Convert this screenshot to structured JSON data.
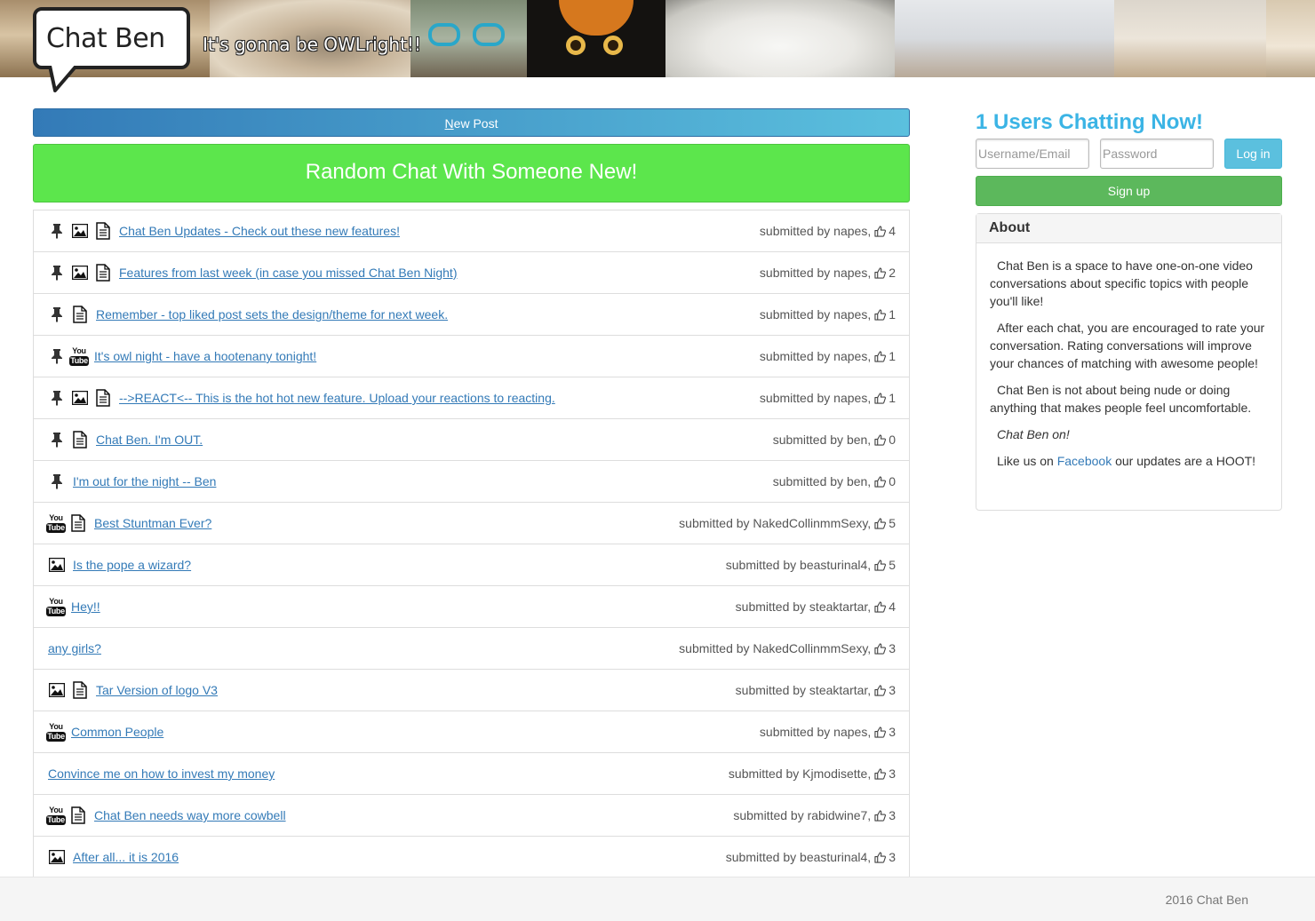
{
  "header": {
    "logo": "Chat Ben",
    "tagline": "It's gonna be OWLright!!"
  },
  "main": {
    "new_post": {
      "underlined": "N",
      "rest": "ew Post"
    },
    "random_chat": "Random Chat With Someone New!",
    "posts": [
      {
        "pinned": true,
        "icons": [
          "image-icon",
          "document-icon"
        ],
        "title": "Chat Ben Updates - Check out these new features!",
        "submitted": "submitted by napes,",
        "likes": "4"
      },
      {
        "pinned": true,
        "icons": [
          "image-icon",
          "document-icon"
        ],
        "title": "Features from last week (in case you missed Chat Ben Night)",
        "submitted": "submitted by napes,",
        "likes": "2"
      },
      {
        "pinned": true,
        "icons": [
          "document-icon"
        ],
        "title": "Remember - top liked post sets the design/theme for next week.",
        "submitted": "submitted by napes,",
        "likes": "1"
      },
      {
        "pinned": true,
        "icons": [
          "youtube-icon"
        ],
        "title": "It's owl night - have a hootenany tonight!",
        "submitted": "submitted by napes,",
        "likes": "1"
      },
      {
        "pinned": true,
        "icons": [
          "image-icon",
          "document-icon"
        ],
        "title": "-->REACT<-- This is the hot hot new feature. Upload your reactions to reacting.",
        "submitted": "submitted by napes,",
        "likes": "1"
      },
      {
        "pinned": true,
        "icons": [
          "document-icon"
        ],
        "title": "Chat Ben. I'm OUT.",
        "submitted": "submitted by ben,",
        "likes": "0"
      },
      {
        "pinned": true,
        "icons": [],
        "title": "I'm out for the night -- Ben",
        "submitted": "submitted by ben,",
        "likes": "0"
      },
      {
        "pinned": false,
        "icons": [
          "youtube-icon",
          "document-icon"
        ],
        "title": "Best Stuntman Ever?",
        "submitted": "submitted by NakedCollinmmSexy,",
        "likes": "5"
      },
      {
        "pinned": false,
        "icons": [
          "image-icon"
        ],
        "title": "Is the pope a wizard?",
        "submitted": "submitted by beasturinal4,",
        "likes": "5"
      },
      {
        "pinned": false,
        "icons": [
          "youtube-icon"
        ],
        "title": "Hey!!",
        "submitted": "submitted by steaktartar,",
        "likes": "4"
      },
      {
        "pinned": false,
        "icons": [],
        "title": "any girls?",
        "submitted": "submitted by NakedCollinmmSexy,",
        "likes": "3"
      },
      {
        "pinned": false,
        "icons": [
          "image-icon",
          "document-icon"
        ],
        "title": "Tar Version of logo V3",
        "submitted": "submitted by steaktartar,",
        "likes": "3"
      },
      {
        "pinned": false,
        "icons": [
          "youtube-icon"
        ],
        "title": "Common People",
        "submitted": "submitted by napes,",
        "likes": "3"
      },
      {
        "pinned": false,
        "icons": [],
        "title": "Convince me on how to invest my money",
        "submitted": "submitted by Kjmodisette,",
        "likes": "3"
      },
      {
        "pinned": false,
        "icons": [
          "youtube-icon",
          "document-icon"
        ],
        "title": "Chat Ben needs way more cowbell",
        "submitted": "submitted by rabidwine7,",
        "likes": "3"
      },
      {
        "pinned": false,
        "icons": [
          "image-icon"
        ],
        "title": "After all... it is 2016",
        "submitted": "submitted by beasturinal4,",
        "likes": "3"
      }
    ]
  },
  "sidebar": {
    "chatting": "1 Users Chatting Now!",
    "username_placeholder": "Username/Email",
    "password_placeholder": "Password",
    "login": "Log in",
    "signup": "Sign up",
    "about": {
      "title": "About",
      "p1": "Chat Ben is a space to have one-on-one video conversations about specific topics with people you'll like!",
      "p2": "After each chat, you are encouraged to rate your conversation. Rating conversations will improve your chances of matching with awesome people!",
      "p3": "Chat Ben is not about being nude or doing anything that makes people feel uncomfortable.",
      "p4": "Chat Ben on!",
      "p5_before": "Like us on ",
      "p5_link": "Facebook",
      "p5_after": " our updates are a HOOT!"
    }
  },
  "footer": {
    "text": "2016 Chat Ben"
  },
  "colors": {
    "link": "#337ab7",
    "accent": "#3bb4e5",
    "random_green": "#5ce64c",
    "signup_green": "#5cb85c",
    "login_blue": "#5bc0de"
  }
}
